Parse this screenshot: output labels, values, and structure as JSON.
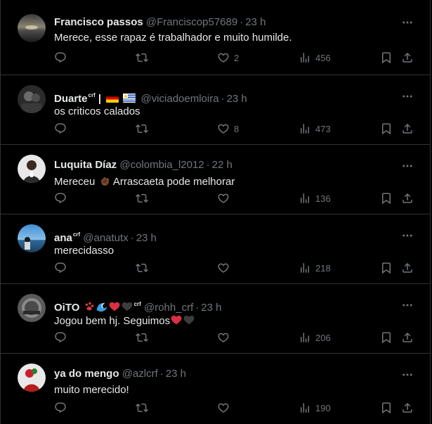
{
  "colors": {
    "background": "#000000",
    "text": "#e7e9ea",
    "muted": "#71767b",
    "border": "#2f3336",
    "heart": "#f91880",
    "dark_heart": "#3c3c3c"
  },
  "icons": {
    "reply": "reply-icon",
    "retweet": "retweet-icon",
    "like": "heart-icon",
    "views": "views-icon",
    "bookmark": "bookmark-icon",
    "share": "share-icon",
    "more": "more-icon"
  },
  "tweets": [
    {
      "name": "Francisco passos",
      "handle": "@Franciscop57689",
      "dot": "·",
      "time": "23 h",
      "text": "Merece, esse rapaz é trabalhador e muito humilde.",
      "replies": "",
      "retweets": "",
      "likes": "2",
      "views": "456"
    },
    {
      "name": "Duarte",
      "badge": "crf",
      "separator": "|",
      "handle": "@viciadoemloira",
      "dot": "·",
      "time": "23 h",
      "text": "os criticos calados",
      "replies": "",
      "retweets": "",
      "likes": "8",
      "views": "473"
    },
    {
      "name": "Luquita Díaz",
      "handle": "@colombia_l2012",
      "dot": "·",
      "time": "22 h",
      "text_before": "Mereceu",
      "text_after": "Arrascaeta pode melhorar",
      "replies": "",
      "retweets": "",
      "likes": "",
      "views": "136"
    },
    {
      "name": "ana",
      "badge": "crf",
      "handle": "@anatutx",
      "dot": "·",
      "time": "23 h",
      "text": "merecidasso",
      "replies": "",
      "retweets": "",
      "likes": "",
      "views": "218"
    },
    {
      "name": "OiTO",
      "badge": "crf",
      "handle": "@rohh_crf",
      "dot": "·",
      "time": "23 h",
      "text": "Jogou bem hj. Seguimos",
      "replies": "",
      "retweets": "",
      "likes": "",
      "views": "206"
    },
    {
      "name": "ya do mengo",
      "handle": "@azlcrf",
      "dot": "·",
      "time": "23 h",
      "text": "muito merecido!",
      "replies": "",
      "retweets": "",
      "likes": "",
      "views": "190"
    }
  ]
}
